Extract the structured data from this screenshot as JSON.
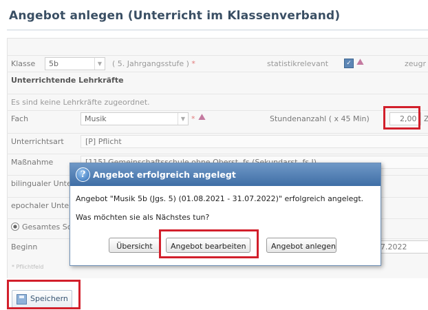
{
  "page": {
    "title": "Angebot anlegen (Unterricht im Klassenverband)"
  },
  "form": {
    "klasse": {
      "label": "Klasse",
      "value": "5b",
      "hint": "( 5. Jahrgangsstufe )",
      "required_mark": "*"
    },
    "statistik": {
      "label": "statistikrelevant",
      "checked": true,
      "cut_label": "zeugr"
    },
    "lehrkraefte": {
      "heading": "Unterrichtende Lehrkräfte",
      "empty_text": "Es sind keine Lehrkräfte zugeordnet."
    },
    "fach": {
      "label": "Fach",
      "value": "Musik",
      "required_mark": "*"
    },
    "stunden": {
      "label": "Stundenanzahl ( x 45 Min)",
      "value": "2,00",
      "cut_suffix": "Z"
    },
    "unterrichtsart": {
      "label": "Unterrichtsart",
      "value": "[P] Pflicht"
    },
    "massnahme": {
      "label": "Maßnahme",
      "value": "[115] Gemeinschaftsschule ohne Oberst. fs (Sekundarst. fs I)"
    },
    "bilingual": {
      "label": "bilingualer Unterricht"
    },
    "epochal": {
      "label": "epochaler Unterricht"
    },
    "gesamt": {
      "label": "Gesamtes Schuljahr",
      "selected": true
    },
    "beginn": {
      "label": "Beginn",
      "end_value": "7.2022"
    },
    "pflicht_note": "* Pflichtfeld"
  },
  "dialog": {
    "title": "Angebot erfolgreich angelegt",
    "message": "Angebot \"Musik 5b (Jgs. 5) (01.08.2021 - 31.07.2022)\" erfolgreich angelegt.",
    "question": "Was möchten sie als Nächstes tun?",
    "buttons": {
      "overview": "Übersicht",
      "edit": "Angebot bearbeiten",
      "create": "Angebot anlegen"
    }
  },
  "footer": {
    "save_label": "Speichern"
  },
  "colors": {
    "highlight": "#d21f2b",
    "dialog_header": "#4a78ad",
    "title": "#3a4f64"
  }
}
